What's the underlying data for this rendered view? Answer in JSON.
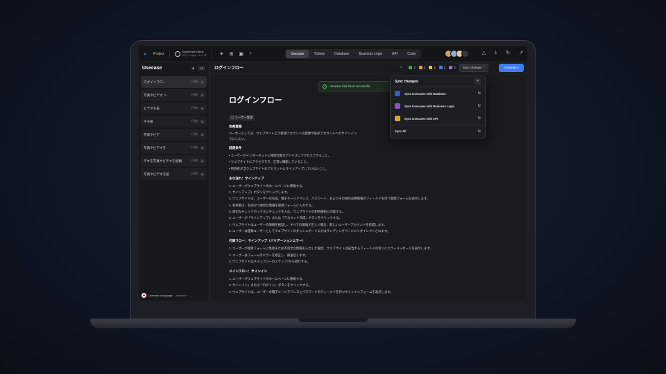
{
  "topbar": {
    "project": "Project",
    "github_title": "Synced with Github",
    "github_sub": "#2 (1 hr ago) • 1 hr 32",
    "tabs": [
      "Usecase",
      "Tickets",
      "Database",
      "Business Logic",
      "API",
      "Code"
    ],
    "active_tab": "Usecase"
  },
  "sidebar": {
    "title": "Usecase",
    "count": "13",
    "items": [
      {
        "label": "ログインフロー",
        "count": "1行前",
        "warn": false
      },
      {
        "label": "写真やビデオ",
        "count": "1行前",
        "warn": true
      },
      {
        "label": "ビデオを投",
        "count": "1行前",
        "warn": false
      },
      {
        "label": "オモ投",
        "count": "1行前",
        "warn": false
      },
      {
        "label": "写真やビデ",
        "count": "1行前",
        "warn": false
      },
      {
        "label": "写真やビデオを",
        "count": "1行前",
        "warn": false
      },
      {
        "label": "デオを写真やビデオを投稿",
        "count": "1行前",
        "warn": false
      },
      {
        "label": "写真やビデオを投",
        "count": "1行前",
        "warn": false
      }
    ],
    "language_label": "Usecase Language:",
    "language_value": "Japanese"
  },
  "header": {
    "title": "ログインフロー",
    "stats": [
      "2",
      "2",
      "2",
      "2",
      "2"
    ],
    "sync_label": "Sync changes",
    "generate_label": "Generate"
  },
  "toast": {
    "message": "Usecase has been successful"
  },
  "dropdown": {
    "title": "Sync changes",
    "items": [
      "Sync Usecases with Database",
      "Sync Usecases with Business Logic",
      "Sync Usecases with API"
    ],
    "all_label": "Sync All"
  },
  "doc": {
    "title": "ログインフロー",
    "tag": "ユーザー登録",
    "s1_title": "会員登録",
    "s1_text": "ユーザーとしては、ウェブサイト上で新規アカウントの登録や既存アカウントへのサインイン",
    "s1_text_b": "できるよ",
    "s1_text2": "うにしたい。",
    "s2_title": "前提条件",
    "s2_items": [
      "• ユーザーがインターネットに接続可能なデバイスにアクセスできること。",
      "• ウェブサイトにアクセスでき、正常に機能していること。",
      "• 利用者が当ウェブサイトのアカウントにサインアップしていないこと。"
    ],
    "s3_title": "主な流れ：サインアップ",
    "s3_items": [
      "1. ユーザーがウェブサイトのホームページに移動する。",
      "2. サインアップ」ボタンをクリックします。",
      "3. ウェブサイトは、ユーザーの名前、電子メールアドレス、パスワード、およびその他の必要情報のフィールドを持つ登録フォームを表示します。",
      "4. 利用者は、有効かつ適切な情報を登録フォームに入力する。",
      "5. 適切なチェックボックスにチェックを入れ、ウェブサイトの利用規約に同意する。",
      "6. ユーザーが「サインアップ」または「アカウント作成」ボタンをクリックする。",
      "7. ウェブサイトはユーザーの情報を検証し、すべての情報が正しい場合、新しいユーザーアカウントを作成します。",
      "8. ユーザーは登録ユーザーとしてウェブサイトのダッシュボードまたはランディングページにリダイレクトされます。"
    ],
    "s4_title": "代替フロー：サインアップ（バリデーションエラー）",
    "s4_items": [
      "1. ユーザーが登録フォームに無効または不完全な情報を入力した場合、ウェブサイトは該当するフィールドの近くにエラーメッセージを表示します。",
      "2. ユーザーはフォームのエラーを修正し、再送信します。",
      "3. ウェブサイトはメインフローのステップ7から続行する。"
    ],
    "s5_title": "メインフロー：サインイン",
    "s5_items": [
      "1. ユーザーがウェブサイトのホームページに移動する。",
      "2. サインイン」または「ログイン」ボタンをクリックする。",
      "3. ウェブサイトは、ユーザーの電子メールアドレスとパスワードのフィールドを持つサインインフォームを表示します。"
    ]
  },
  "colors": {
    "accent": "#3d7cf5",
    "success": "#5fcf73",
    "warning": "#e8c24a"
  }
}
